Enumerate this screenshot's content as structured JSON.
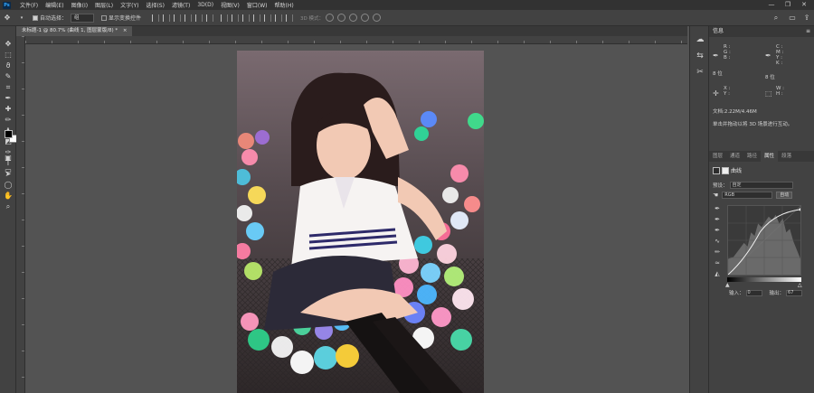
{
  "app": {
    "logo": "Ps"
  },
  "menu": [
    "文件(F)",
    "编辑(E)",
    "图像(I)",
    "图层(L)",
    "文字(Y)",
    "选择(S)",
    "滤镜(T)",
    "3D(D)",
    "视图(V)",
    "窗口(W)",
    "帮助(H)"
  ],
  "window_controls": {
    "minimize": "—",
    "maximize": "❐",
    "close": "✕"
  },
  "options": {
    "auto_select_label": "自动选择：",
    "auto_select_value": "组",
    "show_transform_label": "显示变换控件",
    "mode3d_label": "3D 模式："
  },
  "document": {
    "tab_label": "未标题-1 @ 80.7% (曲线 1, 图层蒙版/8) *",
    "close": "×"
  },
  "info_panel": {
    "title": "信息",
    "left_labels": "R :\nG :\nB :",
    "right_labels": "C :\nM :\nY :\nK :",
    "bit_left": "8 位",
    "bit_right": "8 位",
    "xy_labels": "X :\nY :",
    "wh_labels": "W :\nH :",
    "doc_size": "文档:2.22M/4.46M",
    "hint": "单击并拖动以将 3D 场景进行互动。"
  },
  "panel_tabs": [
    {
      "label": "图层",
      "active": false
    },
    {
      "label": "通道",
      "active": false
    },
    {
      "label": "路径",
      "active": false
    },
    {
      "label": "属性",
      "active": true
    },
    {
      "label": "段落",
      "active": false
    }
  ],
  "properties": {
    "title": "曲线",
    "preset_label": "预设：",
    "preset_value": "自定",
    "channel_value": "RGB",
    "auto_label": "自动",
    "input_label": "输入：",
    "input_value": "0",
    "output_label": "输出：",
    "output_value": "67"
  },
  "colors": {
    "accent": "#31a8ff",
    "workspace": "#535353",
    "panel": "#424242",
    "menubar": "#323232"
  }
}
